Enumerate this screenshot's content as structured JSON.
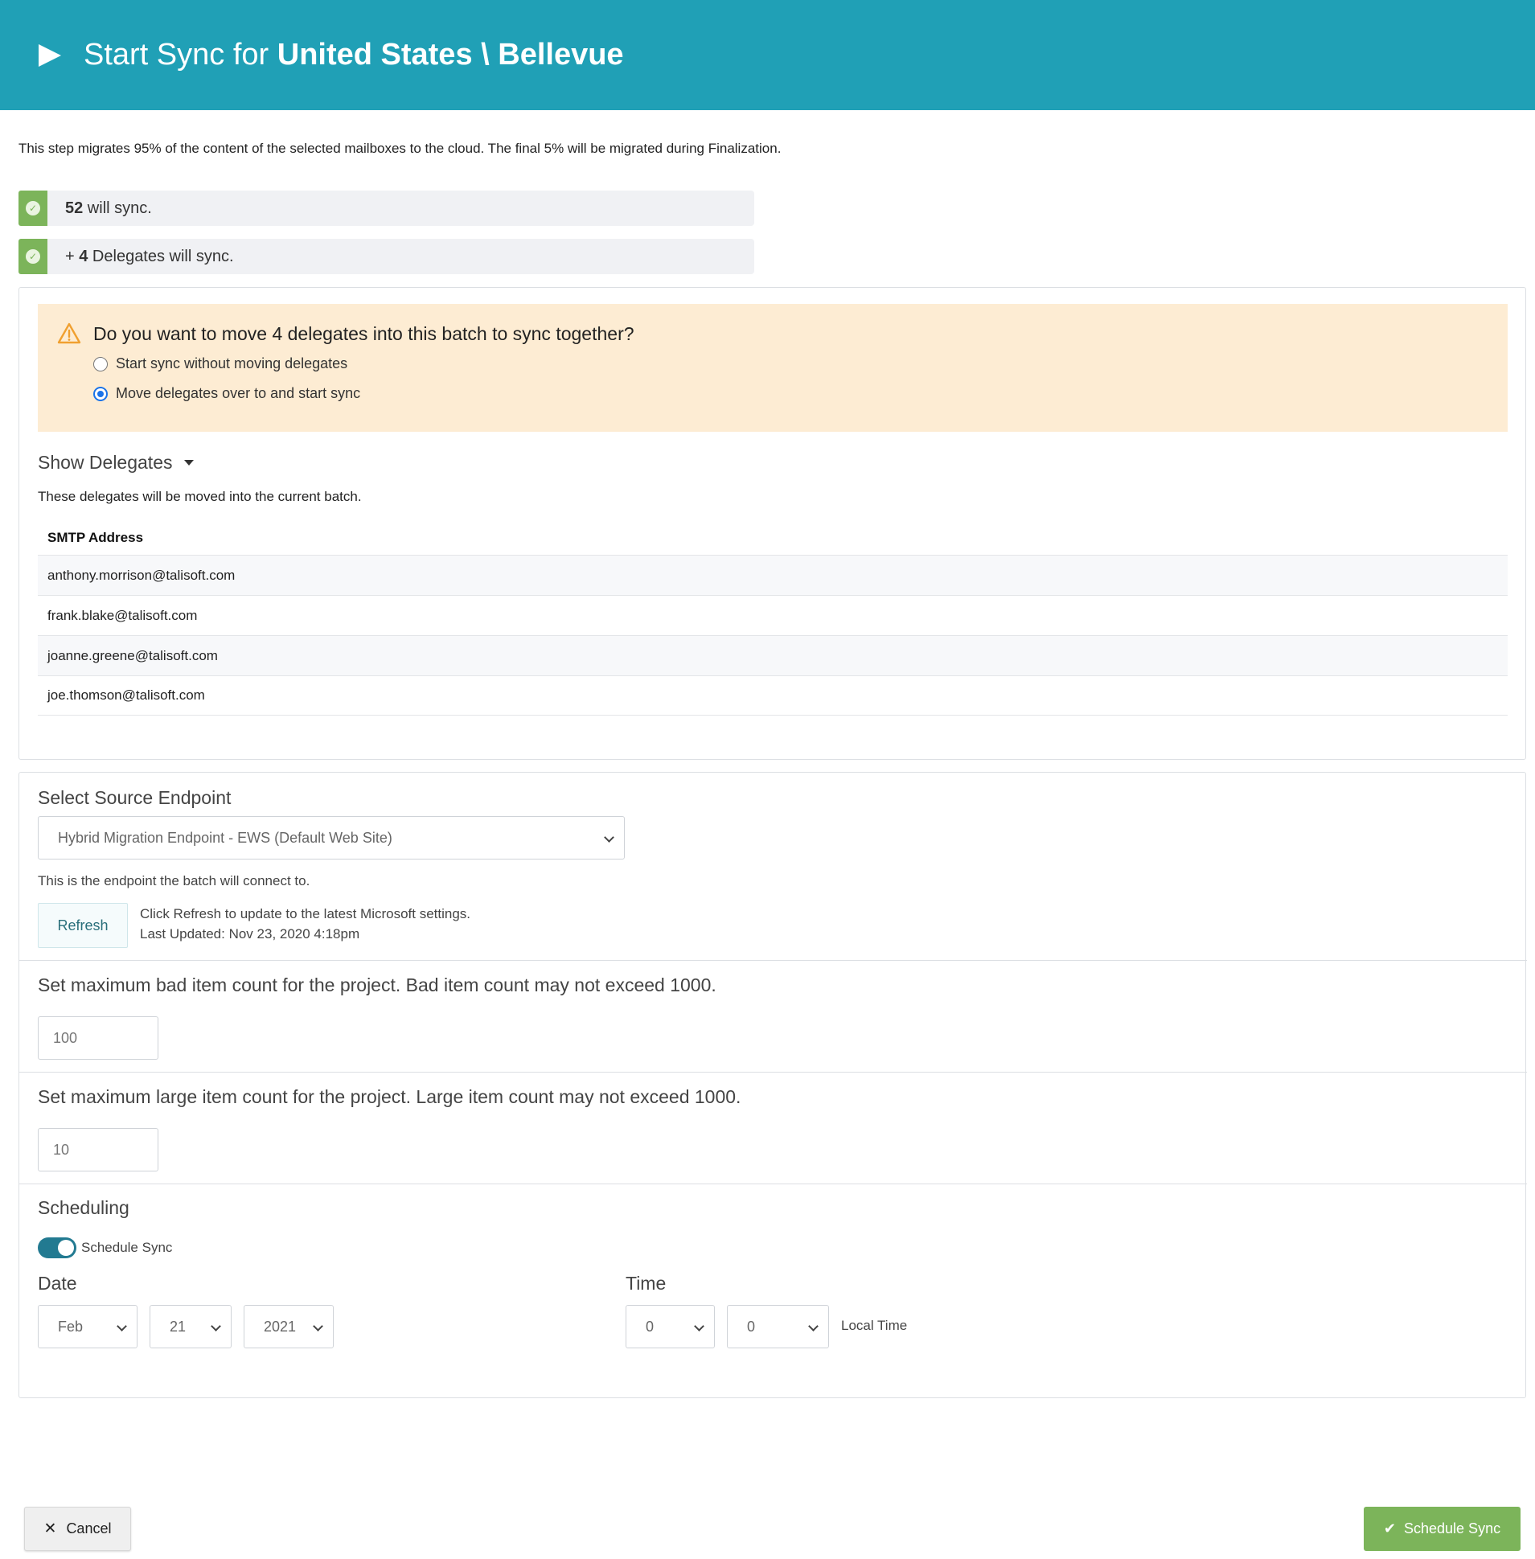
{
  "header": {
    "title_prefix": "Start Sync for ",
    "title_bold": "United States \\ Bellevue"
  },
  "intro_text": "This step migrates 95% of the content of the selected mailboxes to the cloud. The final 5% will be migrated during Finalization.",
  "status": {
    "sync_count": "52",
    "sync_suffix": " will sync.",
    "delegates_prefix": "+ ",
    "delegates_count": "4",
    "delegates_suffix": " Delegates will sync."
  },
  "delegates_panel": {
    "question": "Do you want to move 4 delegates into this batch to sync together?",
    "option_1": "Start sync without moving delegates",
    "option_2": "Move delegates over to and start sync",
    "selected_option": 2,
    "show_delegates": "Show Delegates",
    "note": "These delegates will be moved into the current batch.",
    "table_header": "SMTP Address",
    "rows": [
      "anthony.morrison@talisoft.com",
      "frank.blake@talisoft.com",
      "joanne.greene@talisoft.com",
      "joe.thomson@talisoft.com"
    ]
  },
  "endpoint": {
    "title": "Select Source Endpoint",
    "selected": "Hybrid Migration Endpoint - EWS (Default Web Site)",
    "help": "This is the endpoint the batch will connect to.",
    "refresh_label": "Refresh",
    "refresh_note": "Click Refresh to update to the latest Microsoft settings.",
    "last_updated": "Last Updated: Nov 23, 2020 4:18pm"
  },
  "bad_items": {
    "title": "Set maximum bad item count for the project. Bad item count may not exceed 1000.",
    "value": "100"
  },
  "large_items": {
    "title": "Set maximum large item count for the project. Large item count may not exceed 1000.",
    "value": "10"
  },
  "scheduling": {
    "title": "Scheduling",
    "toggle_label": "Schedule Sync",
    "toggle_on": true,
    "date_label": "Date",
    "month": "Feb",
    "day": "21",
    "year": "2021",
    "time_label": "Time",
    "hour": "0",
    "minute": "0",
    "tz_label": "Local Time"
  },
  "footer": {
    "cancel_label": "Cancel",
    "schedule_label": "Schedule Sync"
  },
  "colors": {
    "header_bg": "#20a0b6",
    "success_green": "#7cb45a",
    "warning_bg": "#fdecd3",
    "warning_icon": "#f0a030",
    "toggle_on": "#227a91"
  }
}
